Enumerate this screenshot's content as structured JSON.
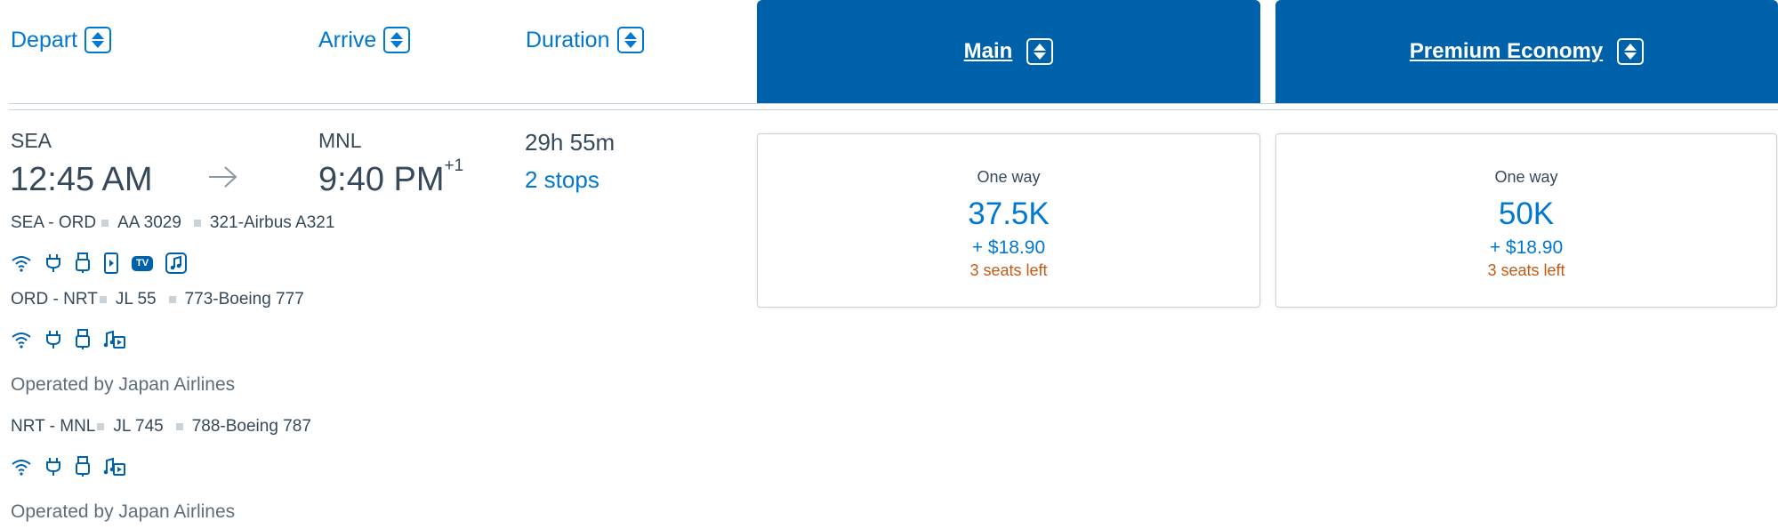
{
  "header": {
    "depart_label": "Depart",
    "arrive_label": "Arrive",
    "duration_label": "Duration",
    "cabins": [
      {
        "label": "Main"
      },
      {
        "label": "Premium Economy"
      }
    ]
  },
  "flight": {
    "origin": "SEA",
    "depart_time": "12:45 AM",
    "destination": "MNL",
    "arrive_time": "9:40 PM",
    "arrive_day_offset": "+1",
    "duration": "29h 55m",
    "stops": "2 stops",
    "segments": [
      {
        "route": "SEA - ORD",
        "flight_no": "AA 3029",
        "aircraft": "321-Airbus A321",
        "amenities": [
          "wifi-icon",
          "power-outlet-icon",
          "usb-icon",
          "on-demand-video-icon",
          "live-tv-icon",
          "music-icon"
        ],
        "tv_badge": "TV",
        "operated_by": ""
      },
      {
        "route": "ORD - NRT",
        "flight_no": "JL 55",
        "aircraft": "773-Boeing 777",
        "amenities": [
          "wifi-icon",
          "power-outlet-icon",
          "usb-icon",
          "entertainment-icon"
        ],
        "operated_by": "Operated by Japan Airlines"
      },
      {
        "route": "NRT - MNL",
        "flight_no": "JL 745",
        "aircraft": "788-Boeing 787",
        "amenities": [
          "wifi-icon",
          "power-outlet-icon",
          "usb-icon",
          "entertainment-icon"
        ],
        "operated_by": "Operated by Japan Airlines"
      }
    ]
  },
  "fares": [
    {
      "cabin": "Main",
      "trip_type": "One way",
      "miles": "37.5K",
      "fee": "+ $18.90",
      "seats_left": "3 seats left"
    },
    {
      "cabin": "Premium Economy",
      "trip_type": "One way",
      "miles": "50K",
      "fee": "+ $18.90",
      "seats_left": "3 seats left"
    }
  ],
  "colors": {
    "link_blue": "#0078d2",
    "header_blue": "#0061ab",
    "text": "#36495a",
    "seats_orange": "#c45a14",
    "divider": "#c9d2d9"
  }
}
